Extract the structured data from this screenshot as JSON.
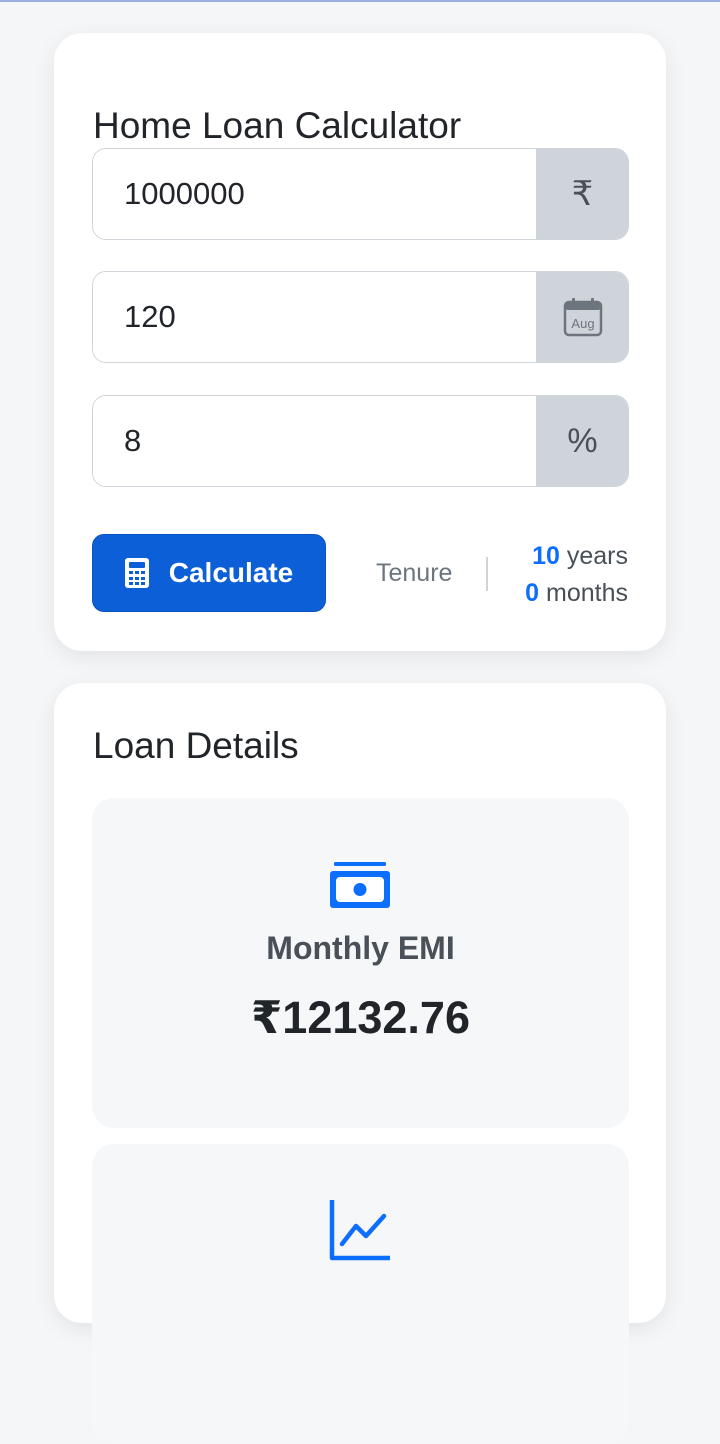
{
  "calculator": {
    "title": "Home Loan Calculator",
    "loan_amount": {
      "value": "1000000",
      "addon_icon": "rupee-icon",
      "addon_text": "₹"
    },
    "tenure_months": {
      "value": "120",
      "addon_icon": "calendar-icon",
      "addon_text": "Aug"
    },
    "interest_rate": {
      "value": "8",
      "addon_icon": "percent-icon",
      "addon_text": "%"
    },
    "calculate_label": "Calculate",
    "calculate_icon": "calculator-icon",
    "tenure_label": "Tenure",
    "tenure_years": "10",
    "years_label": "years",
    "tenure_months_value": "0",
    "months_label": "months"
  },
  "loan_details": {
    "title": "Loan Details",
    "emi": {
      "icon": "cash-icon",
      "label": "Monthly EMI",
      "value": "₹12132.76"
    },
    "next_icon": "line-chart-icon"
  },
  "colors": {
    "primary": "#0d5fd8",
    "accent": "#0d6efd",
    "addon_bg": "#ced4da",
    "page_bg": "#f5f6f8"
  }
}
